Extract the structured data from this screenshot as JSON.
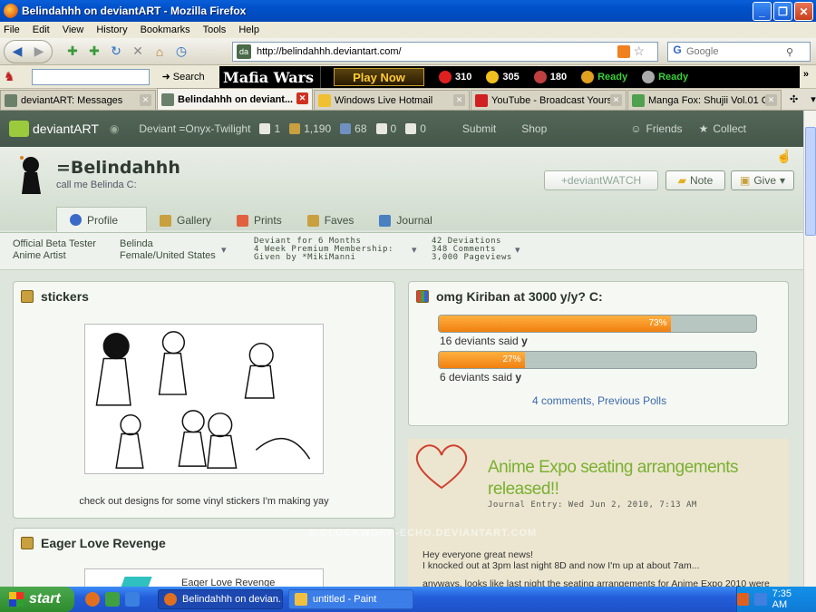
{
  "window": {
    "title": "Belindahhh on deviantART - Mozilla Firefox"
  },
  "menu": [
    "File",
    "Edit",
    "View",
    "History",
    "Bookmarks",
    "Tools",
    "Help"
  ],
  "nav": {
    "url": "http://belindahhh.deviantart.com/",
    "search_placeholder": "Google"
  },
  "toolbar2": {
    "search_label": "Search"
  },
  "mafia": {
    "logo": "Mafia Wars",
    "play": "Play Now",
    "health": "310",
    "energy": "305",
    "stamina": "180",
    "ready1": "Ready",
    "ready2": "Ready"
  },
  "tabs": [
    {
      "label": "deviantART: Messages"
    },
    {
      "label": "Belindahhh on deviant..."
    },
    {
      "label": "Windows Live Hotmail"
    },
    {
      "label": "YouTube - Broadcast Yours..."
    },
    {
      "label": "Manga Fox: Shujii Vol.01 C..."
    }
  ],
  "da": {
    "brand": "deviantART",
    "user": "Deviant =Onyx-Twilight",
    "n1": "1",
    "n2": "1,190",
    "n3": "68",
    "n4": "0",
    "n5": "0",
    "submit": "Submit",
    "shop": "Shop",
    "friends": "Friends",
    "collect": "Collect"
  },
  "profile": {
    "name": "=Belindahhh",
    "tagline": "call me Belinda C:",
    "watch": "+deviantWATCH",
    "note": "Note",
    "give": "Give",
    "tabs": [
      "Profile",
      "Gallery",
      "Prints",
      "Faves",
      "Journal"
    ],
    "info": {
      "c1a": "Official Beta Tester",
      "c1b": "Anime Artist",
      "c2a": "Belinda",
      "c2b": "Female/United States",
      "c3a": "Deviant for 6 Months",
      "c3b": "4 Week Premium Membership:",
      "c3c": "Given by *MikiManni",
      "c4a": "42 Deviations",
      "c4b": "348 Comments",
      "c4c": "3,000 Pageviews"
    }
  },
  "stickers": {
    "title": "stickers",
    "caption": "check out designs for some vinyl stickers I'm making yay"
  },
  "eager": {
    "title": "Eager Love Revenge",
    "thumb_text": "Eager Love Revenge"
  },
  "poll": {
    "title": "omg Kiriban at 3000 y/y? C:",
    "items": [
      {
        "pct": "73%",
        "fraction": 0.73,
        "text": "16 deviants said",
        "answer": "y"
      },
      {
        "pct": "27%",
        "fraction": 0.27,
        "text": "6 deviants said",
        "answer": "y"
      }
    ],
    "comments": "4 comments",
    "sep": ",",
    "previous": "Previous Polls"
  },
  "journal": {
    "title": "Anime Expo seating arrangements released!!",
    "meta": "Journal Entry: Wed Jun 2, 2010, 7:13 AM",
    "p1": "Hey everyone great news!",
    "p2": "I knocked out at 3pm last night 8D and now I'm up at about 7am...",
    "p3": "anyways, looks like last night the seating arrangements for Anime Expo 2010 were"
  },
  "watermark": "© CLOCKWORK-ECHO.DEVIANTART.COM",
  "taskbar": {
    "start": "start",
    "task1": "Belindahhh on devian...",
    "task2": "untitled - Paint",
    "clock": "7:35 AM"
  }
}
